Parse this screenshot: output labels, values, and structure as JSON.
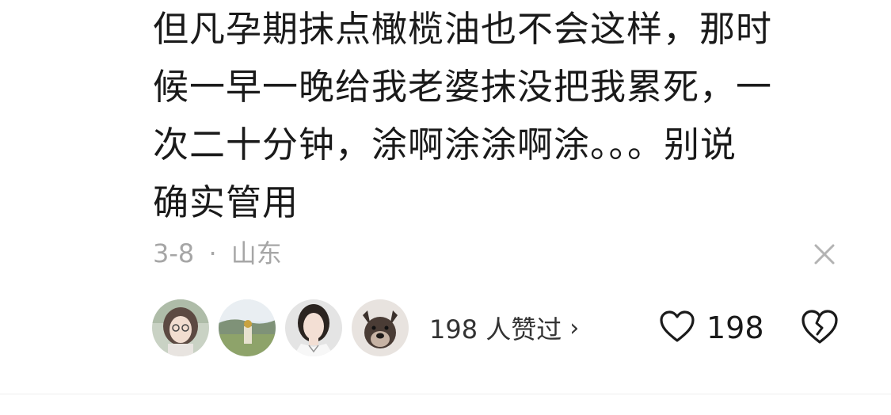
{
  "comment": {
    "lines": [
      "但凡孕期抹点橄榄油也不会这样，那时",
      "候一早一晚给我老婆抹没把我累死，一",
      "次二十分钟，涂啊涂涂啊涂。。。别说",
      "确实管用"
    ],
    "date": "3-8",
    "separator": "·",
    "location": "山东"
  },
  "likers": {
    "avatars": [
      "avatar-girl-glasses",
      "avatar-landscape-person",
      "avatar-woman-portrait",
      "avatar-bulldog"
    ],
    "text": "198 人赞过",
    "chevron": "›"
  },
  "actions": {
    "like_icon": "heart-outline-icon",
    "like_count": "198",
    "dislike_icon": "broken-heart-icon",
    "close_icon": "close-icon"
  }
}
